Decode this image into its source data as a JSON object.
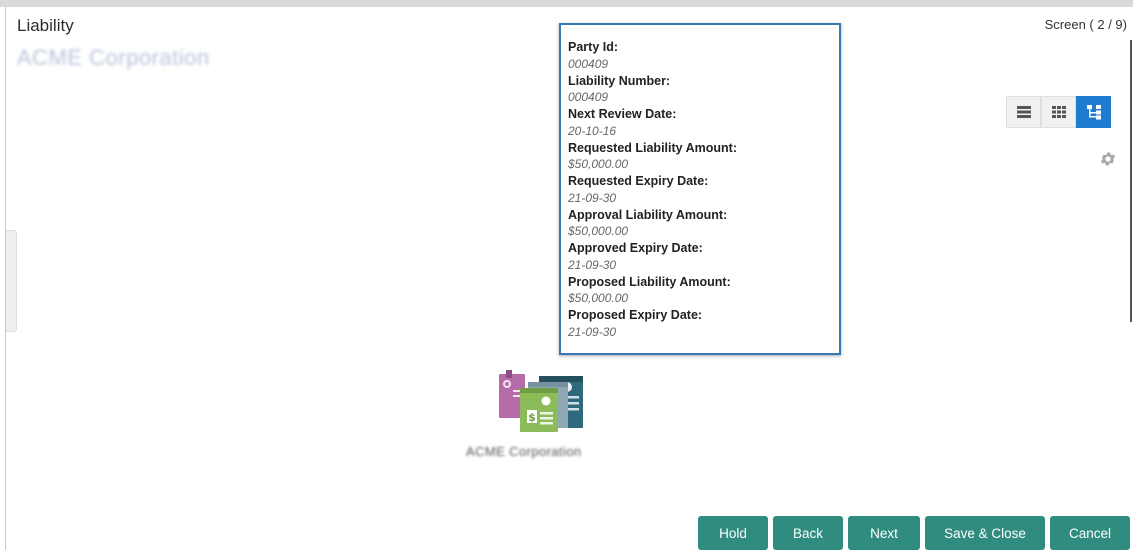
{
  "header": {
    "title": "Liability",
    "company_name": "ACME Corporation",
    "screen_counter": "Screen ( 2 / 9)"
  },
  "view_toggle": {
    "options": [
      "list-view-icon",
      "grid-view-icon",
      "tree-view-icon"
    ],
    "active": "tree-view-icon",
    "active_color": "#1f7bd0"
  },
  "tooltip": {
    "fields": [
      {
        "label": "Party Id:",
        "value": "000409"
      },
      {
        "label": "Liability Number:",
        "value": "000409"
      },
      {
        "label": "Next Review Date:",
        "value": "20-10-16"
      },
      {
        "label": "Requested Liability Amount:",
        "value": "$50,000.00"
      },
      {
        "label": "Requested Expiry Date:",
        "value": "21-09-30"
      },
      {
        "label": "Approval Liability Amount:",
        "value": "$50,000.00"
      },
      {
        "label": "Approved Expiry Date:",
        "value": "21-09-30"
      },
      {
        "label": "Proposed Liability Amount:",
        "value": "$50,000.00"
      },
      {
        "label": "Proposed Expiry Date:",
        "value": "21-09-30"
      }
    ]
  },
  "node": {
    "company_name": "ACME Corporation"
  },
  "footer": {
    "hold": "Hold",
    "back": "Back",
    "next": "Next",
    "save_close": "Save & Close",
    "cancel": "Cancel",
    "button_color": "#2f8c7e"
  }
}
